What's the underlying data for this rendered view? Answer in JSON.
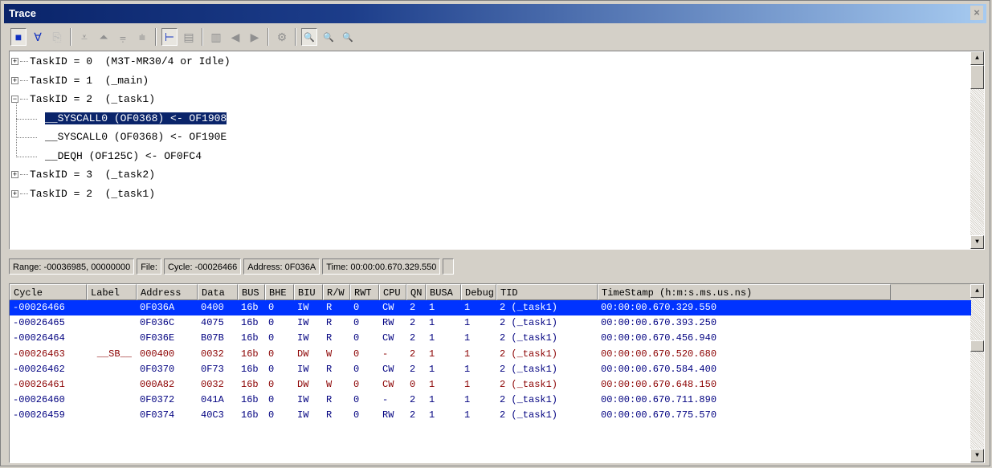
{
  "window": {
    "title": "Trace",
    "close_glyph": "×"
  },
  "toolbar": {
    "buttons": [
      {
        "name": "record-button",
        "glyph": "■",
        "state": "on"
      },
      {
        "name": "filter-button",
        "glyph": "∀",
        "state": "normal"
      },
      {
        "name": "copy-button",
        "glyph": "⎘",
        "state": "dim"
      },
      {
        "name": "sep"
      },
      {
        "name": "scroll-bottom-button",
        "glyph": "⩡",
        "state": "grey"
      },
      {
        "name": "scroll-top-button",
        "glyph": "⏶",
        "state": "grey"
      },
      {
        "name": "zoom-in-button",
        "glyph": "⩦",
        "state": "grey"
      },
      {
        "name": "zoom-out-button",
        "glyph": "⩧",
        "state": "grey"
      },
      {
        "name": "sep"
      },
      {
        "name": "tree-view-button",
        "glyph": "⊢",
        "state": "on"
      },
      {
        "name": "list-view-button",
        "glyph": "▤",
        "state": "grey"
      },
      {
        "name": "sep"
      },
      {
        "name": "mixed-view-button",
        "glyph": "▥",
        "state": "grey"
      },
      {
        "name": "step-back-button",
        "glyph": "◀",
        "state": "grey"
      },
      {
        "name": "step-forward-button",
        "glyph": "▶",
        "state": "grey"
      },
      {
        "name": "sep"
      },
      {
        "name": "properties-button",
        "glyph": "⚙",
        "state": "grey"
      },
      {
        "name": "sep"
      },
      {
        "name": "find-button",
        "glyph": "🔍",
        "state": "on"
      },
      {
        "name": "find-next-button",
        "glyph": "🔍",
        "state": "normal"
      },
      {
        "name": "find-prev-button",
        "glyph": "🔍",
        "state": "normal"
      }
    ]
  },
  "tree": {
    "nodes": [
      {
        "level": 0,
        "expander": "+",
        "text": "TaskID = 0  (M3T-MR30/4 or Idle)"
      },
      {
        "level": 0,
        "expander": "+",
        "text": "TaskID = 1  (_main)"
      },
      {
        "level": 0,
        "expander": "−",
        "text": "TaskID = 2  (_task1)"
      },
      {
        "level": 1,
        "expander": "",
        "text": "__SYSCALL0 (OF0368) <- OF1908",
        "selected": true
      },
      {
        "level": 1,
        "expander": "",
        "text": "__SYSCALL0 (OF0368) <- OF190E"
      },
      {
        "level": 1,
        "expander": "",
        "text": "__DEQH (OF125C) <- OF0FC4"
      },
      {
        "level": 0,
        "expander": "+",
        "text": "TaskID = 3  (_task2)"
      },
      {
        "level": 0,
        "expander": "+",
        "text": "TaskID = 2  (_task1)"
      }
    ]
  },
  "status": {
    "range": "Range: -00036985, 00000000",
    "file": "File:",
    "cycle": "Cycle: -00026466",
    "address": "Address: 0F036A",
    "time": "Time: 00:00:00.670.329.550"
  },
  "table": {
    "columns": [
      "Cycle",
      "Label",
      "Address",
      "Data",
      "BUS",
      "BHE",
      "BIU",
      "R/W",
      "RWT",
      "CPU",
      "QN",
      "BUSA",
      "Debug",
      "TID",
      "TimeStamp (h:m:s.ms.us.ns)"
    ],
    "rows": [
      {
        "style": "selected",
        "cells": [
          "-00026466",
          "",
          "0F036A",
          "0400",
          "16b",
          "0",
          "IW",
          "R",
          "0",
          "CW",
          "2",
          "1",
          "1",
          "2 (_task1)",
          "00:00:00.670.329.550"
        ]
      },
      {
        "style": "blue",
        "cells": [
          "-00026465",
          "",
          "0F036C",
          "4075",
          "16b",
          "0",
          "IW",
          "R",
          "0",
          "RW",
          "2",
          "1",
          "1",
          "2 (_task1)",
          "00:00:00.670.393.250"
        ]
      },
      {
        "style": "blue",
        "cells": [
          "-00026464",
          "",
          "0F036E",
          "B07B",
          "16b",
          "0",
          "IW",
          "R",
          "0",
          "CW",
          "2",
          "1",
          "1",
          "2 (_task1)",
          "00:00:00.670.456.940"
        ]
      },
      {
        "style": "red",
        "cells": [
          "-00026463",
          "__SB__",
          "000400",
          "0032",
          "16b",
          "0",
          "DW",
          "W",
          "0",
          "-",
          "2",
          "1",
          "1",
          "2 (_task1)",
          "00:00:00.670.520.680"
        ]
      },
      {
        "style": "blue",
        "cells": [
          "-00026462",
          "",
          "0F0370",
          "0F73",
          "16b",
          "0",
          "IW",
          "R",
          "0",
          "CW",
          "2",
          "1",
          "1",
          "2 (_task1)",
          "00:00:00.670.584.400"
        ]
      },
      {
        "style": "red",
        "cells": [
          "-00026461",
          "",
          "000A82",
          "0032",
          "16b",
          "0",
          "DW",
          "W",
          "0",
          "CW",
          "0",
          "1",
          "1",
          "2 (_task1)",
          "00:00:00.670.648.150"
        ]
      },
      {
        "style": "blue",
        "cells": [
          "-00026460",
          "",
          "0F0372",
          "041A",
          "16b",
          "0",
          "IW",
          "R",
          "0",
          "-",
          "2",
          "1",
          "1",
          "2 (_task1)",
          "00:00:00.670.711.890"
        ]
      },
      {
        "style": "blue",
        "cells": [
          "-00026459",
          "",
          "0F0374",
          "40C3",
          "16b",
          "0",
          "IW",
          "R",
          "0",
          "RW",
          "2",
          "1",
          "1",
          "2 (_task1)",
          "00:00:00.670.775.570"
        ]
      }
    ]
  },
  "colors": {
    "selection": "#0033ff",
    "tree_selection": "#0a246a",
    "instruction_row": "#000080",
    "data_write_row": "#8b0000"
  }
}
